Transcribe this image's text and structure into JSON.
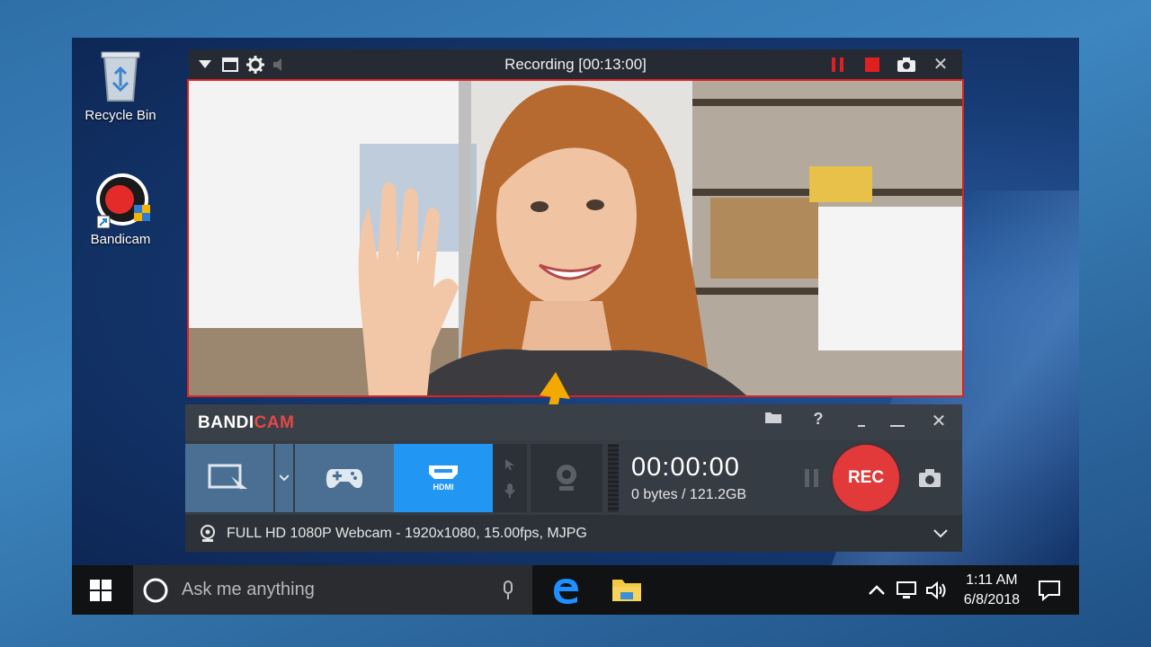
{
  "desktop": {
    "icons": [
      {
        "label": "Recycle Bin",
        "icon": "recycle-bin-icon"
      },
      {
        "label": "Bandicam",
        "icon": "bandicam-app-icon"
      }
    ]
  },
  "recording_bar": {
    "title": "Recording [00:13:00]",
    "left_icons": [
      "dropdown-triangle-icon",
      "window-icon",
      "gear-icon",
      "speaker-icon"
    ],
    "right_icons": [
      "pause-icon",
      "stop-icon",
      "camera-icon",
      "close-icon"
    ],
    "accent": "#e02020"
  },
  "bandicam": {
    "brand_left": "BANDI",
    "brand_right": "CAM",
    "controls": [
      "folder-icon",
      "help-icon",
      "minimize-icon",
      "maximize-icon",
      "close-icon"
    ],
    "help_label": "?",
    "modes": [
      {
        "name": "screen-record-mode",
        "icon": "rectangle-select-icon",
        "active": false
      },
      {
        "name": "game-record-mode",
        "icon": "gamepad-icon",
        "active": false
      },
      {
        "name": "device-record-mode",
        "icon": "hdmi-icon",
        "label": "HDMI",
        "active": true
      }
    ],
    "timer": "00:00:00",
    "size": "0 bytes / 121.2GB",
    "rec_label": "REC",
    "status_text": "FULL HD 1080P Webcam - 1920x1080, 15.00fps, MJPG",
    "colors": {
      "rec": "#e23a3a",
      "active_mode": "#2196f3",
      "mode": "#4a6f93"
    }
  },
  "taskbar": {
    "search_placeholder": "Ask me anything",
    "time": "1:11 AM",
    "date": "6/8/2018"
  }
}
